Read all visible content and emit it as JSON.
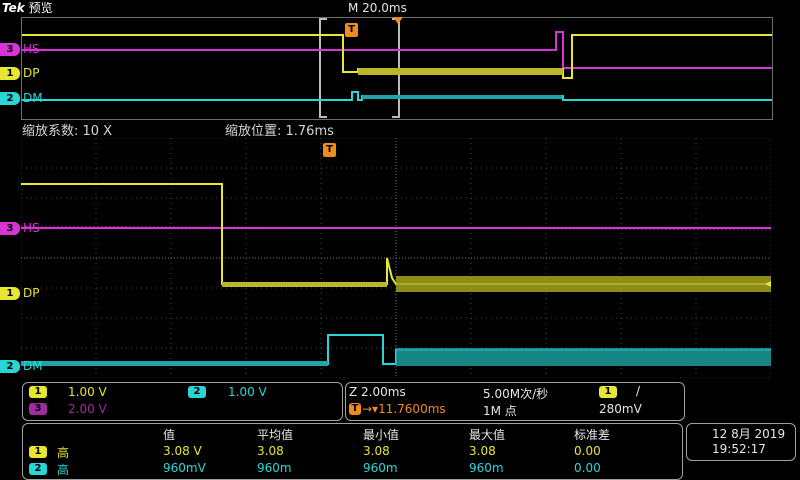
{
  "header": {
    "brand": "Tek",
    "mode": "预览",
    "timebase": "M 20.0ms"
  },
  "channels": [
    {
      "num": "3",
      "name": "HS",
      "color": "#d733d7"
    },
    {
      "num": "1",
      "name": "DP",
      "color": "#e6e633"
    },
    {
      "num": "2",
      "name": "DM",
      "color": "#29d6d6"
    }
  ],
  "trigger_marker": "T",
  "zoom": {
    "factor_label": "缩放系数: 10 X",
    "position_label": "缩放位置: 1.76ms"
  },
  "vertical": {
    "ch1": {
      "num": "1",
      "scale": "1.00 V"
    },
    "ch2": {
      "num": "2",
      "scale": "1.00 V"
    },
    "ch3": {
      "num": "3",
      "scale": "2.00 V"
    }
  },
  "horizontal": {
    "zoom_scale": "Z 2.00ms",
    "sample_rate": "5.00M次/秒",
    "trig_channel": "1",
    "trig_slope": "/",
    "trig_position": "→▾11.7600ms",
    "record_length": "1M 点",
    "trig_level": "280mV"
  },
  "measurements": {
    "headers": [
      "值",
      "平均值",
      "最小值",
      "最大值",
      "标准差"
    ],
    "rows": [
      {
        "channel": "1",
        "label": "高",
        "values": [
          "3.08 V",
          "3.08",
          "3.08",
          "3.08",
          "0.00"
        ]
      },
      {
        "channel": "2",
        "label": "高",
        "values": [
          "960mV",
          "960m",
          "960m",
          "960m",
          "0.00"
        ]
      }
    ]
  },
  "datetime": {
    "date": "12 8月 2019",
    "time": "19:52:17"
  }
}
